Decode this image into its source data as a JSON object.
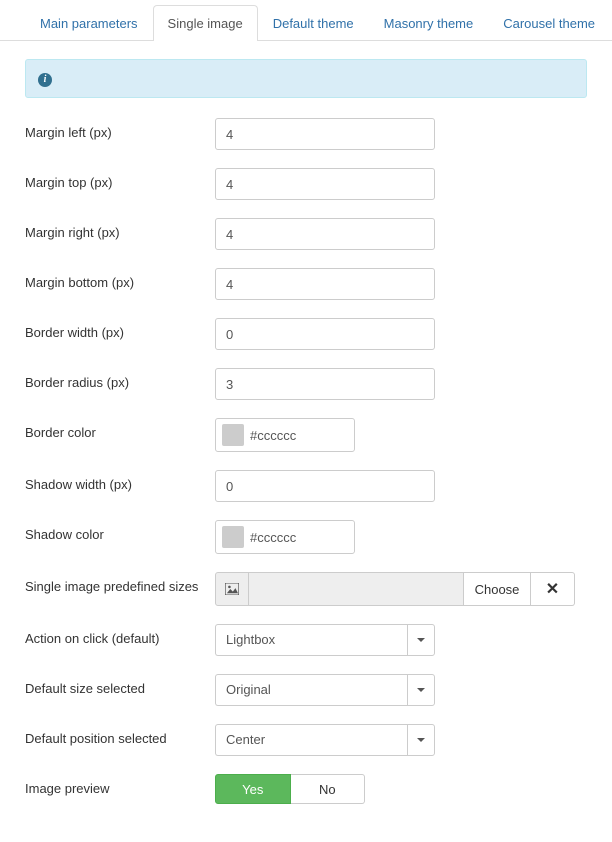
{
  "tabs": {
    "t0": "Main parameters",
    "t1": "Single image",
    "t2": "Default theme",
    "t3": "Masonry theme",
    "t4": "Carousel theme"
  },
  "labels": {
    "margin_left": "Margin left (px)",
    "margin_top": "Margin top (px)",
    "margin_right": "Margin right (px)",
    "margin_bottom": "Margin bottom (px)",
    "border_width": "Border width (px)",
    "border_radius": "Border radius (px)",
    "border_color": "Border color",
    "shadow_width": "Shadow width (px)",
    "shadow_color": "Shadow color",
    "predefined_sizes": "Single image predefined sizes",
    "action_on_click": "Action on click (default)",
    "default_size": "Default size selected",
    "default_position": "Default position selected",
    "image_preview": "Image preview"
  },
  "values": {
    "margin_left": "4",
    "margin_top": "4",
    "margin_right": "4",
    "margin_bottom": "4",
    "border_width": "0",
    "border_radius": "3",
    "border_color": "#cccccc",
    "shadow_width": "0",
    "shadow_color": "#cccccc",
    "action_on_click": "Lightbox",
    "default_size": "Original",
    "default_position": "Center"
  },
  "buttons": {
    "choose": "Choose",
    "yes": "Yes",
    "no": "No"
  }
}
